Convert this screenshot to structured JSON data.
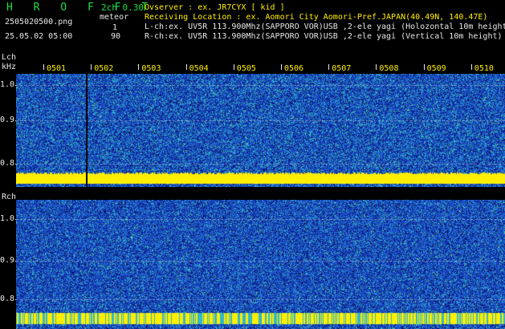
{
  "header": {
    "app_title": "H R O F F T",
    "mode": "2ch 0.30",
    "filename": "2505020500.png",
    "datetime": "25.05.02 05:00",
    "meteor_label": "meteor",
    "meteor_lch": "1",
    "meteor_rch": "90",
    "observer_line": "Ovserver             : ex. JR7CYX [ kid ]",
    "location_line": "Receiving Location : ex. Aomori City Aomori-Pref.JAPAN(40.49N, 140.47E)",
    "lch_line": "L-ch:ex. UV5R 113.900Mhz(SAPPORO VOR)USB ,2-ele yagi (Holozontal 10m height)",
    "rch_line": "R-ch:ex. UV5R 113.900Mhz(SAPPORO VOR)USB ,2-ele yagi (Vertical 10m height)"
  },
  "lch": {
    "label": "Lch",
    "unit": "kHz",
    "y_ticks": [
      "1.0",
      "0.9",
      "0.8"
    ]
  },
  "rch": {
    "label": "Rch",
    "y_ticks": [
      "1.0",
      "0.9",
      "0.8"
    ]
  },
  "time_ticks": [
    "0501",
    "0502",
    "0503",
    "0504",
    "0505",
    "0506",
    "0507",
    "0508",
    "0509",
    "0510"
  ],
  "colors": {
    "background": "#000000",
    "header_green": "#22dd44",
    "header_white": "#e8e8e8",
    "tick_yellow": "#ffee00",
    "signal_yellow": "#ffee00",
    "noise_blue": "#1a3fb0",
    "noise_cyan": "#33b8c8"
  }
}
